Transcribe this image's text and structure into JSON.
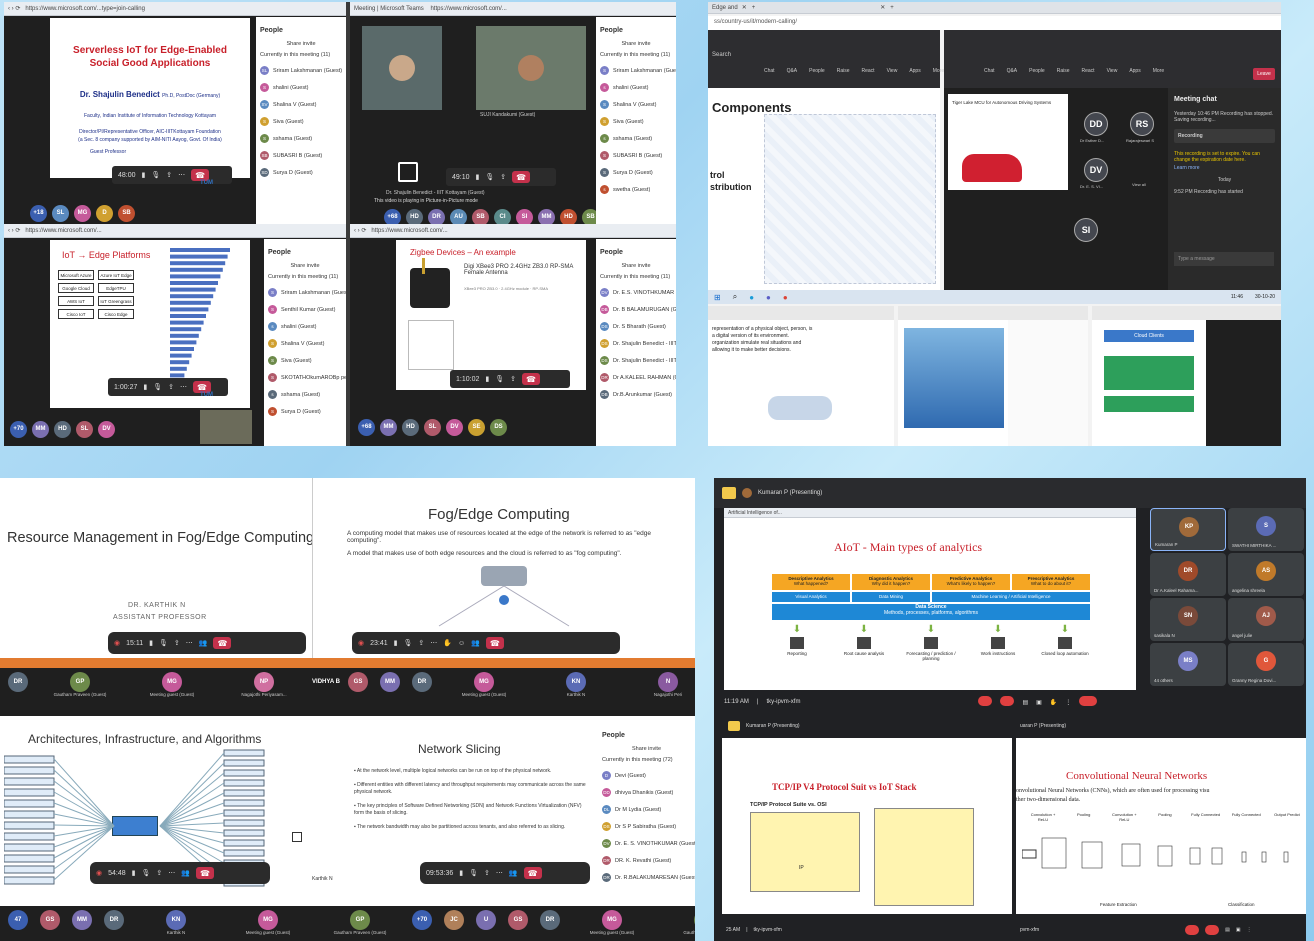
{
  "tl": {
    "slide1": {
      "title": "Serverless IoT for Edge-Enabled Social Good Applications",
      "presenter": "Dr. Shajulin Benedict",
      "presenter_suffix": "Ph.D, PostDoc (Germany)",
      "faculty": "Faculty, Indian Institute of Information Technology Kottayam",
      "director": "Director/PI/Representative Officer, AIC-IIITKottayam Foundation",
      "sec8": "(a Sec. 8 company supported by AIM-NITI Aayog, Govt. Of India)",
      "guest": "Guest Professor"
    },
    "people_title": "People",
    "share_invite": "Share invite",
    "in_meeting": "Currently in this meeting (11)",
    "people1": [
      "Sriram Lakshmanan (Guest)",
      "shalini (Guest)",
      "Shalina V (Guest)",
      "Siva (Guest)",
      "sshama (Guest)",
      "SUBASRI B (Guest)",
      "Surya D (Guest)"
    ],
    "people1_initials": [
      "SL",
      "S",
      "SV",
      "S",
      "S",
      "SB",
      "SD"
    ],
    "cam_name_left": "Dr. Shajulin Benedict - IIIT Kottayam (Guest)",
    "cam_name_right": "SUJI Kandakumi (Guest)",
    "cam_video_msg": "This video is playing in Picture-in-Picture mode",
    "people2": [
      "Sriram Lakshmanan (Guest)",
      "shalini (Guest)",
      "Shalina V (Guest)",
      "Siva (Guest)",
      "sshama (Guest)",
      "SUBASRI B (Guest)",
      "Surya D (Guest)",
      "swetha (Guest)"
    ],
    "slide3": {
      "title": "IoT → Edge Platforms",
      "platforms": [
        "Microsoft Azure",
        "Azure IoT Edge",
        "Google Cloud IoT",
        "EdgeTPU",
        "AWS IoT",
        "IoT Greengrass",
        "Cisco IoT",
        "Cisco Edge"
      ]
    },
    "people3_title": "People",
    "people3": [
      "Sriram Lakshmanan (Guest)",
      "Senthil Kumar (Guest)",
      "shalini (Guest)",
      "Shalina V (Guest)",
      "Siva (Guest)",
      "SKOTATHOkumAROBp pembicara...",
      "sshama (Guest)",
      "Surya D (Guest)"
    ],
    "slide4": {
      "title": "Zigbee Devices – An example",
      "product": "Digi XBee3 PRO 2.4GHz ZB3.0 RP-SMA Female Antenna"
    },
    "people4": [
      "Dr. E.S. VINOTHKUMAR (Guest)",
      "Dr. B BALAMURUGAN (Guest)",
      "Dr. S Bharath (Guest)",
      "Dr. Shajulin Benedict - IIIT Kottay...",
      "Dr. Shajulin Benedict - IIITKottayam (...",
      "Dr A.KALEEL RAHMAN (Guest)",
      "Dr.B.Arunkumar (Guest)"
    ],
    "people4_initials": [
      "DV",
      "DB",
      "DS",
      "DS",
      "DS",
      "DR",
      "DB"
    ]
  },
  "tr": {
    "tab1": "Edge and",
    "url": "ss/country-us/it/modern-calling/",
    "search": "Search",
    "heading": "Components",
    "side1": "trol",
    "side2": "stribution",
    "toolbar": [
      "Chat",
      "Q&A",
      "People",
      "Raise",
      "React",
      "View",
      "Apps",
      "More"
    ],
    "tiger": "Tiger Lake MCU for Autonomous Driving Systems",
    "avatars": [
      "DD",
      "RS",
      "DV",
      "SI"
    ],
    "avatar_names": [
      "Dr Esther D...",
      "Rajarajeswari S",
      "Dr. E. S. VI...",
      "View all"
    ],
    "chat_title": "Meeting chat",
    "chat_time1": "Yesterday 10:46 PM",
    "chat_msg1": "Recording has stopped. Saving recording...",
    "chat_recording": "Recording",
    "chat_msg2": "This recording is set to expire. You can change the expiration date here.",
    "chat_learn": "Learn more",
    "chat_today": "Today",
    "chat_time2": "9:52 PM",
    "chat_msg3": "Recording has started",
    "chat_input": "Type a message",
    "slide_left_text": "representation of a physical object, person, is a digital version of its environment. organization simulate real situations and allowing it to make better decisions.",
    "cloud_clients": "Cloud Clients",
    "time": "11:46",
    "date": "30-10-20"
  },
  "bl": {
    "s1_title": "Resource Management in Fog/Edge Computing",
    "s1_name": "DR. KARTHIK N",
    "s1_role": "ASSISTANT PROFESSOR",
    "s1_time": "15:11",
    "s2_title": "Fog/Edge Computing",
    "s2_b1": "A computing model that makes use of resources located at the edge of the network is referred to as \"edge computing\".",
    "s2_b2": "A model that makes use of both edge resources and the cloud is referred to as \"fog computing\".",
    "s2_time": "23:41",
    "strip1": [
      {
        "i": "DR",
        "c": "#5a6a7a"
      },
      {
        "i": "GP",
        "c": "#6d8a4a",
        "n": "Gautham Praveen (Guest)"
      },
      {
        "i": "MG",
        "c": "#c55a9a",
        "n": "Meeting guest (Guest)"
      },
      {
        "i": "NP",
        "c": "#d06fa0",
        "n": "Nagajothi Periyasam..."
      },
      {
        "i": "VIDHYA B",
        "c": "#00000000"
      }
    ],
    "strip2": [
      {
        "i": "GS",
        "c": "#b05a6a"
      },
      {
        "i": "MM",
        "c": "#7a6fb0"
      },
      {
        "i": "DR",
        "c": "#5a6a7a"
      },
      {
        "i": "MG",
        "c": "#c55a9a",
        "n": "Meeting guest (Guest)"
      },
      {
        "i": "KN",
        "c": "#5b6bb5",
        "n": "Karthik N"
      },
      {
        "i": "N",
        "c": "#8a5aa0",
        "n": "Nagajothi Peri"
      }
    ],
    "s3_title": "Architectures, Infrastructure, and Algorithms",
    "s3_time": "54:48",
    "s4_title": "Network Slicing",
    "s4_bullets": [
      "At the network level, multiple logical networks can be run on top of the physical network.",
      "Different entities with different latency and throughput requirements may communicate across the same physical network.",
      "The key principles of Software Defined Networking (SDN) and Network Functions Virtualization (NFV) form the basis of slicing.",
      "The network bandwidth may also be partitioned across tenants, and also referred to as slicing."
    ],
    "s4_time": "09:53:36",
    "people_title": "People",
    "share_invite": "Share invite",
    "in_meeting": "Currently in this meeting (72)",
    "people": [
      "Devi (Guest)",
      "dhivya Dhanikis (Guest)",
      "Dr M Lydia (Guest)",
      "Dr S P Sabiratha (Guest)",
      "Dr. E. S. VINOTHKUMAR (Guest)",
      "DR. K. Revathi (Guest)",
      "Dr. R.BALAKUMARESAN (Guest)"
    ],
    "people_initials": [
      "D",
      "DD",
      "DL",
      "DS",
      "DV",
      "DR",
      "DR"
    ],
    "karthik_label": "Karthik N",
    "strip3": [
      {
        "i": "47",
        "c": "#3b5fb0"
      },
      {
        "i": "GS",
        "c": "#b05a6a"
      },
      {
        "i": "MM",
        "c": "#7a6fb0"
      },
      {
        "i": "DR",
        "c": "#5a6a7a"
      },
      {
        "i": "KN",
        "c": "#5b6bb5",
        "n": "Karthik N"
      },
      {
        "i": "MG",
        "c": "#c55a9a",
        "n": "Meeting guest (Guest)"
      },
      {
        "i": "GP",
        "c": "#6d8a4a",
        "n": "Gautham Praveen (Guest)"
      }
    ],
    "strip4": [
      {
        "i": "+70",
        "c": "#3b5fb0"
      },
      {
        "i": "JC",
        "c": "#b0805a"
      },
      {
        "i": "U",
        "c": "#7a6fb0"
      },
      {
        "i": "GS",
        "c": "#b05a6a"
      },
      {
        "i": "DR",
        "c": "#5a6a7a"
      },
      {
        "i": "MG",
        "c": "#c55a9a",
        "n": "Meeting guest (Guest)"
      },
      {
        "i": "GP",
        "c": "#6d8a4a",
        "n": "Gautham Praveen G"
      },
      {
        "i": "KN",
        "c": "#5b6bb5",
        "n": "Karthik N"
      }
    ]
  },
  "br": {
    "presenting": "Kumaran P (Presenting)",
    "tab": "Artificial Intelligence of...",
    "title": "AIoT - Main types of analytics",
    "analytics": [
      {
        "t": "Descriptive Analytics",
        "s": "What happened?"
      },
      {
        "t": "Diagnostic Analytics",
        "s": "Why did it happen?"
      },
      {
        "t": "Predictive Analytics",
        "s": "What's likely to happen?"
      },
      {
        "t": "Prescriptive Analytics",
        "s": "What to do about it?"
      }
    ],
    "bars": [
      "Visual Analytics",
      "Data Mining",
      "Machine Learning / Artificial Intelligence"
    ],
    "ds_title": "Data Science",
    "ds_sub": "Methods, processes, platforms, algorithms",
    "outputs": [
      "Reporting",
      "Root cause analysis",
      "Forecasting / prediction / planning",
      "Work instructions",
      "Closed loop automation"
    ],
    "participants": [
      {
        "i": "KP",
        "n": "Kumaran P",
        "c": "#a06a3a"
      },
      {
        "i": "S",
        "n": "SWATHI MIRTHIKA ...",
        "c": "#5b6bb5"
      },
      {
        "i": "DR",
        "n": "Dr A.Kaleel Rahama...",
        "c": "#a04a2a"
      },
      {
        "i": "AS",
        "n": "angelina shreela",
        "c": "#c07a2a"
      },
      {
        "i": "SN",
        "n": "sasikala N",
        "c": "#7a4a3a"
      },
      {
        "i": "AJ",
        "n": "angel julie",
        "c": "#a05a4a"
      },
      {
        "i": "MS",
        "n": "44 others",
        "c": "#7a7fc7"
      },
      {
        "i": "G",
        "n": "Granny Regina Dovi...",
        "c": "#e0573b"
      }
    ],
    "time": "11:19 AM",
    "meet": "tky-ipvm-xfm",
    "bl_presenting": "Kumaran P (Presenting)",
    "tcp_title": "TCP/IP V4 Protocol Suit vs IoT Stack",
    "tcp_sub": "TCP/IP Protocol Suite vs. OSI",
    "ip": "IP",
    "time2": "25 AM",
    "cnn_presenting": "uaran P (Presenting)",
    "cnn_title": "Convolutional Neural Networks",
    "cnn_text1": "onvolutional Neural Networks (CNNs), which are often used for processing visu",
    "cnn_text2": "ther two-dimensional data.",
    "cnn_labels": [
      "Convolution + ReLU",
      "Pooling",
      "Convolution + ReLU",
      "Pooling",
      "Fully Connected",
      "Fully Connected",
      "Output Predict"
    ],
    "cnn_fe": "Feature Extraction",
    "cnn_cl": "Classification",
    "meet2": "pvm-xfm"
  }
}
